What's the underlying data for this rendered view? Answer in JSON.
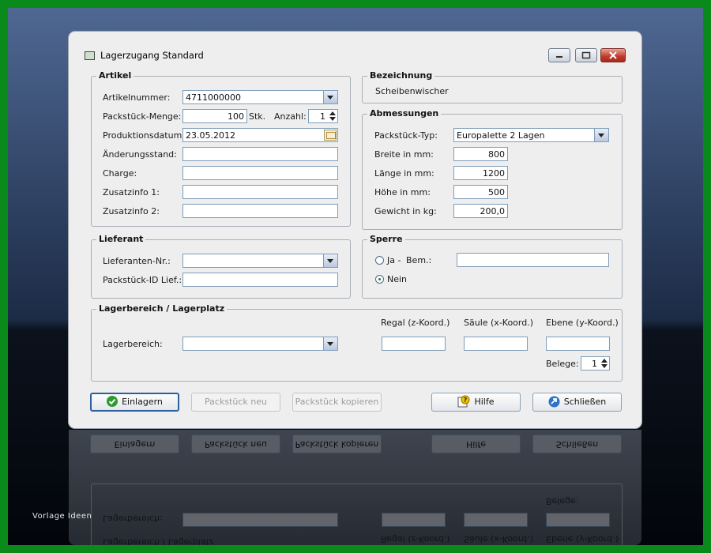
{
  "window": {
    "title": "Lagerzugang Standard"
  },
  "artikel": {
    "legend": "Artikel",
    "artikelnummer_label": "Artikelnummer:",
    "artikelnummer_value": "4711000000",
    "menge_label": "Packstück-Menge:",
    "menge_value": "100",
    "menge_unit": "Stk.",
    "anzahl_label": "Anzahl:",
    "anzahl_value": "1",
    "produktionsdatum_label": "Produktionsdatum:",
    "produktionsdatum_value": "23.05.2012",
    "aenderungsstand_label": "Änderungsstand:",
    "charge_label": "Charge:",
    "zusatzinfo1_label": "Zusatzinfo 1:",
    "zusatzinfo2_label": "Zusatzinfo 2:"
  },
  "bezeichnung": {
    "legend": "Bezeichnung",
    "value": "Scheibenwischer"
  },
  "abmessungen": {
    "legend": "Abmessungen",
    "typ_label": "Packstück-Typ:",
    "typ_value": "Europalette 2 Lagen",
    "breite_label": "Breite in mm:",
    "breite_value": "800",
    "laenge_label": "Länge in mm:",
    "laenge_value": "1200",
    "hoehe_label": "Höhe in mm:",
    "hoehe_value": "500",
    "gewicht_label": "Gewicht in kg:",
    "gewicht_value": "200,0"
  },
  "lieferant": {
    "legend": "Lieferant",
    "nr_label": "Lieferanten-Nr.:",
    "id_label": "Packstück-ID Lief.:"
  },
  "sperre": {
    "legend": "Sperre",
    "ja_label": "Ja -",
    "bem_label": "Bem.:",
    "nein_label": "Nein",
    "selected": "Nein"
  },
  "lager": {
    "legend": "Lagerbereich / Lagerplatz",
    "bereich_label": "Lagerbereich:",
    "regal_label": "Regal (z-Koord.)",
    "saeule_label": "Säule (x-Koord.)",
    "ebene_label": "Ebene (y-Koord.)",
    "belege_label": "Belege:",
    "belege_value": "1"
  },
  "buttons": {
    "einlagern": "Einlagern",
    "packstueck_neu": "Packstück neu",
    "packstueck_kopieren": "Packstück kopieren",
    "hilfe": "Hilfe",
    "schliessen": "Schließen"
  },
  "watermark": "Vorlage Ideen",
  "colors": {
    "window_bg": "#eeeeee",
    "field_border": "#7f9db9",
    "background_top": "#4f6892",
    "frame_green": "#0a8a1a",
    "close_red": "#c0392b"
  },
  "icons": [
    "window-app-icon",
    "minimize-icon",
    "maximize-icon",
    "close-icon",
    "dropdown-arrow-icon",
    "calendar-icon",
    "spin-arrows-icon",
    "checkmark-icon",
    "help-icon",
    "exit-arrow-icon"
  ]
}
